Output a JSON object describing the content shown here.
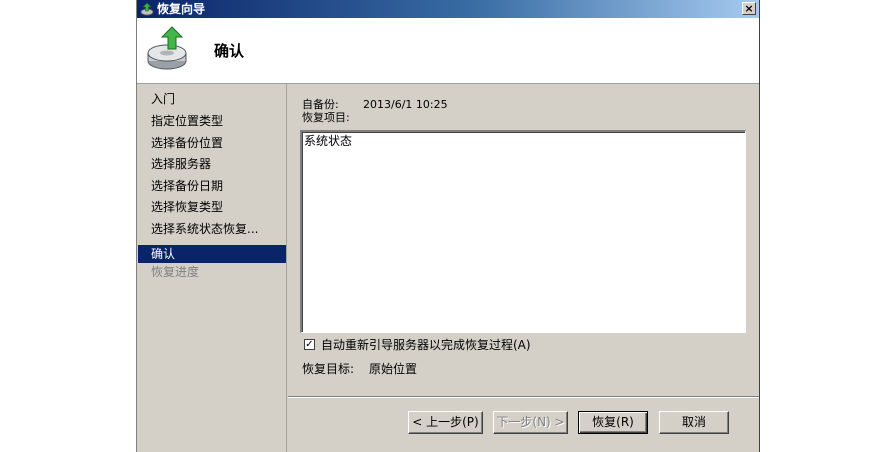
{
  "window": {
    "title": "恢复向导",
    "close_glyph": "×"
  },
  "header": {
    "title": "确认",
    "icon": "backup-restore-disk-icon"
  },
  "nav": {
    "items": [
      {
        "label": "入门",
        "state": "normal"
      },
      {
        "label": "指定位置类型",
        "state": "normal"
      },
      {
        "label": "选择备份位置",
        "state": "normal"
      },
      {
        "label": "选择服务器",
        "state": "normal"
      },
      {
        "label": "选择备份日期",
        "state": "normal"
      },
      {
        "label": "选择恢复类型",
        "state": "normal"
      },
      {
        "label": "选择系统状态恢复...",
        "state": "normal"
      },
      {
        "label": "确认",
        "state": "current"
      },
      {
        "label": "恢复进度",
        "state": "disabled"
      }
    ]
  },
  "main": {
    "backup_from_label": "自备份:",
    "backup_from_value": "2013/6/1 10:25",
    "restore_items_label": "恢复项目:",
    "restore_items": [
      "系统状态"
    ],
    "auto_reboot_checked": true,
    "auto_reboot_label": "自动重新引导服务器以完成恢复过程(A)",
    "restore_target_label": "恢复目标:",
    "restore_target_value": "原始位置"
  },
  "buttons": {
    "back": "< 上一步(P)",
    "next": "下一步(N) >",
    "restore": "恢复(R)",
    "cancel": "取消"
  },
  "colors": {
    "title_bar": "#0a246a",
    "selection": "#0a246a",
    "face": "#d4d0c8"
  }
}
